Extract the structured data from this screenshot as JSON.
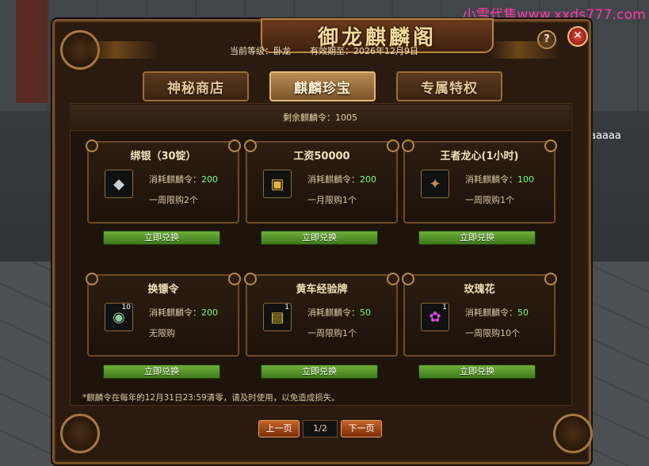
{
  "watermark": "小雪代售www.xxds777.com",
  "scene": {
    "npc_label": "aaaaa"
  },
  "window": {
    "title": "御龙麒麟阁",
    "help_label": "?",
    "close_label": "✕",
    "info": {
      "level": "当前等级：卧龙",
      "expiry": "有效期至：2026年12月9日"
    },
    "tabs": [
      {
        "label": "神秘商店",
        "active": false
      },
      {
        "label": "麒麟珍宝",
        "active": true
      },
      {
        "label": "专属特权",
        "active": false
      }
    ],
    "remaining": "剩余麒麟令：1005",
    "items": [
      {
        "name": "绑银（30锭）",
        "icon": "silver-ingot-icon",
        "glyph": "◆",
        "cost_label": "消耗麒麟令：",
        "cost": "200",
        "limit": "一周限购2个",
        "qty": ""
      },
      {
        "name": "工资50000",
        "icon": "gold-ingot-icon",
        "glyph": "▣",
        "cost_label": "消耗麒麟令：",
        "cost": "200",
        "limit": "一月限购1个",
        "qty": ""
      },
      {
        "name": "王者龙心(1小时)",
        "icon": "dragon-heart-icon",
        "glyph": "✦",
        "cost_label": "消耗麒麟令：",
        "cost": "100",
        "limit": "一周限购1个",
        "qty": ""
      },
      {
        "name": "换镖令",
        "icon": "escort-token-icon",
        "glyph": "◉",
        "cost_label": "消耗麒麟令：",
        "cost": "200",
        "limit": "无限购",
        "qty": "10"
      },
      {
        "name": "黄车经验牌",
        "icon": "yellow-cart-card-icon",
        "glyph": "▤",
        "cost_label": "消耗麒麟令：",
        "cost": "50",
        "limit": "一周限购1个",
        "qty": "1"
      },
      {
        "name": "玫瑰花",
        "icon": "rose-icon",
        "glyph": "✿",
        "cost_label": "消耗麒麟令：",
        "cost": "50",
        "limit": "一周限购10个",
        "qty": "1"
      }
    ],
    "redeem_label": "立即兑换",
    "note": "*麒麟令在每年的12月31日23:59清零，请及时使用，以免造成损失。",
    "pager": {
      "prev": "上一页",
      "page": "1/2",
      "next": "下一页"
    }
  }
}
